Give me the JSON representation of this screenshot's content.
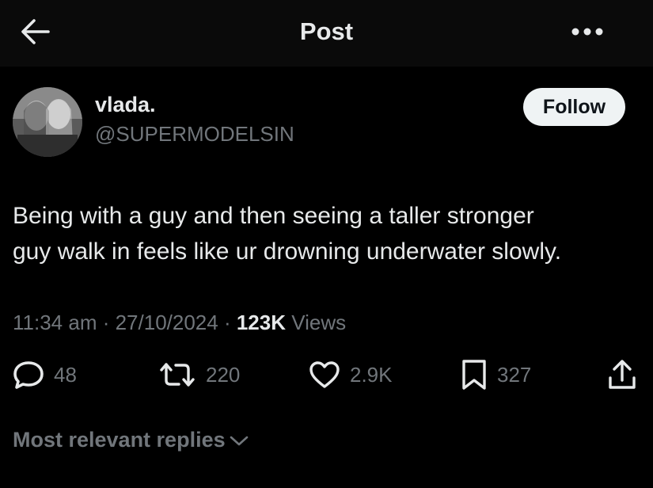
{
  "header": {
    "title": "Post",
    "back_icon": "arrow-left-icon",
    "more_icon": "more-horizontal-icon"
  },
  "author": {
    "name": "vlada.",
    "handle": "@SUPERMODELSIN",
    "follow_label": "Follow"
  },
  "tweet": {
    "text_line1": "Being with a guy and then seeing a taller stronger",
    "text_line2": "guy walk in feels like ur drowning underwater slowly.",
    "time": "11:34 am",
    "sep1": " · ",
    "date": "27/10/2024",
    "sep2": " · ",
    "views_count": "123K",
    "views_label": " Views"
  },
  "actions": {
    "replies": "48",
    "reposts": "220",
    "likes": "2.9K",
    "bookmarks": "327"
  },
  "replies_sort": {
    "label": "Most relevant replies"
  },
  "colors": {
    "background": "#000000",
    "text": "#e7e9ea",
    "muted": "#71767b",
    "follow_bg": "#eff3f4"
  }
}
